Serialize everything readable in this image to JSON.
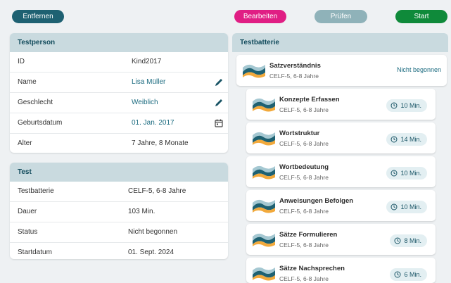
{
  "toolbar": {
    "remove_label": "Entfernen",
    "edit_label": "Bearbeiten",
    "check_label": "Prüfen",
    "start_label": "Start"
  },
  "person": {
    "title": "Testperson",
    "rows": [
      {
        "label": "ID",
        "value": "Kind2017"
      },
      {
        "label": "Name",
        "value": "Lisa Müller"
      },
      {
        "label": "Geschlecht",
        "value": "Weiblich"
      },
      {
        "label": "Geburtsdatum",
        "value": "01. Jan. 2017"
      },
      {
        "label": "Alter",
        "value": "7 Jahre, 8 Monate"
      }
    ]
  },
  "test": {
    "title": "Test",
    "rows": [
      {
        "label": "Testbatterie",
        "value": "CELF-5, 6-8 Jahre"
      },
      {
        "label": "Dauer",
        "value": "103 Min."
      },
      {
        "label": "Status",
        "value": "Nicht begonnen"
      },
      {
        "label": "Startdatum",
        "value": "01. Sept. 2024"
      }
    ]
  },
  "battery": {
    "title": "Testbatterie",
    "main": {
      "title": "Satzverständnis",
      "sub": "CELF-5, 6-8 Jahre",
      "status": "Nicht begonnen"
    },
    "items": [
      {
        "title": "Konzepte Erfassen",
        "sub": "CELF-5, 6-8 Jahre",
        "duration": "10 Min."
      },
      {
        "title": "Wortstruktur",
        "sub": "CELF-5, 6-8 Jahre",
        "duration": "14 Min."
      },
      {
        "title": "Wortbedeutung",
        "sub": "CELF-5, 6-8 Jahre",
        "duration": "10 Min."
      },
      {
        "title": "Anweisungen Befolgen",
        "sub": "CELF-5, 6-8 Jahre",
        "duration": "10 Min."
      },
      {
        "title": "Sätze Formulieren",
        "sub": "CELF-5, 6-8 Jahre",
        "duration": "8 Min."
      },
      {
        "title": "Sätze Nachsprechen",
        "sub": "CELF-5, 6-8 Jahre",
        "duration": "6 Min."
      }
    ]
  },
  "colors": {
    "primary": "#1e6172",
    "edit": "#e01e84",
    "check": "#8fb2b9",
    "start": "#0f8a3a",
    "header_bg": "#c9dadf"
  },
  "icons": {
    "edit": "pencil-icon",
    "calendar": "calendar-icon",
    "clock": "clock-icon",
    "logo": "celf-logo-icon"
  }
}
